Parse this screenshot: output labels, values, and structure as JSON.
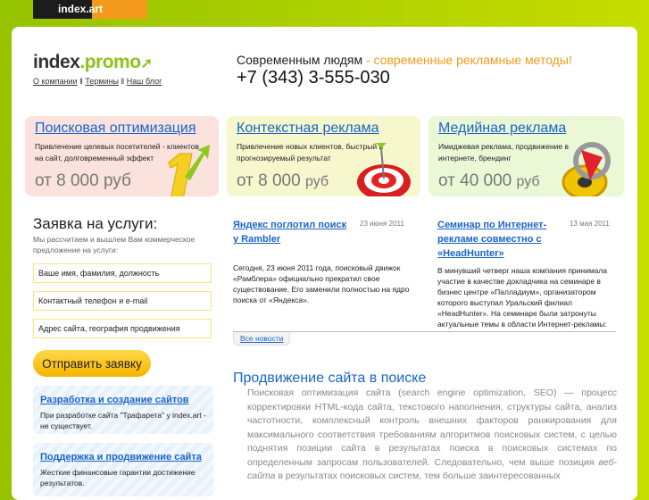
{
  "topbar": {
    "brand": "index.art"
  },
  "header": {
    "logo_main": "index",
    "logo_accent": ".promo",
    "nav": [
      "О компании",
      "Термины",
      "Наш блог"
    ],
    "tagline_black": "Современным людям",
    "tagline_orange": " - современные рекламные методы!",
    "phone": "+7 (343) 3-555-030"
  },
  "services": [
    {
      "title": "Поисковая оптимизация",
      "desc": "Привлечение целевых посетителей - клиентов на сайт, долговременный эффект",
      "price": "от 8 000 руб",
      "icon": "number-one-arrow-icon"
    },
    {
      "title": "Контекстная реклама",
      "desc": "Привлечение новых клиентов, быстрый и прогнозируемый результат",
      "price_num": "от 8 000",
      "price_unit": "руб",
      "icon": "target-icon"
    },
    {
      "title": "Медийная реклама",
      "desc": "Имиджевая реклама, продвижение в интернете, брендинг",
      "price_num": "от 40 000",
      "price_unit": "руб",
      "icon": "film-reel-icon"
    }
  ],
  "form": {
    "title": "Заявка на услуги:",
    "desc": "Мы рассчитаем и вышлем Вам коммерческое предложение на услуги:",
    "fields": [
      "Ваше имя, фамилия, должность",
      "Контактный телефон и e-mail",
      "Адрес сайта, география продвижения"
    ],
    "submit": "Отправить заявку"
  },
  "promos": [
    {
      "title": "Разработка и создание сайтов",
      "desc": "При разработке сайта \"Трафарета\" у index.art - не существует."
    },
    {
      "title": "Поддержка и продвижение сайта",
      "desc": "Жесткие финансовые гарантии достижение результатов."
    }
  ],
  "news": [
    {
      "title": "Яндекс поглотил поиск у Rambler",
      "date": "23 июня 2011",
      "text": "Сегодня, 23 июня 2011 года, поисковый движок «Рамблера» официально прекратил свое существование. Его заменили полностью на ядро поиска от «Яндекса»."
    },
    {
      "title": "Семинар по Интернет-рекламе совместно с «HeadHunter»",
      "date": "13 мая 2011",
      "text": "В минувший четверг наша компания принимала участие в качестве докладчика на семинаре в бизнес центре «Палладиум», организатором которого выступал Уральский филиал «HeadHunter». На семинаре были затронуты актуальные темы в области Интернет-рекламы:"
    }
  ],
  "all_news": "Все новости",
  "seo": {
    "title": "Продвижение сайта в поиске",
    "text": "Поисковая оптимизация сайта (search engine optimization, SEO) — процесс корректировки HTML-кода сайта, текстового наполнения, структуры сайта, анализ частотности, комплексный контроль внешних факторов ранжирования для максимального соответствия требованиям алгоритмов поисковых систем, с целью поднятия позиции сайта в результатах поиска в поисковых системах по определенным запросам пользователей. Следовательно, чем выше позиция",
    "text_italic": "веб-сайта",
    "text_end": " в результатах поисковых систем, тем больше заинтересованных"
  }
}
